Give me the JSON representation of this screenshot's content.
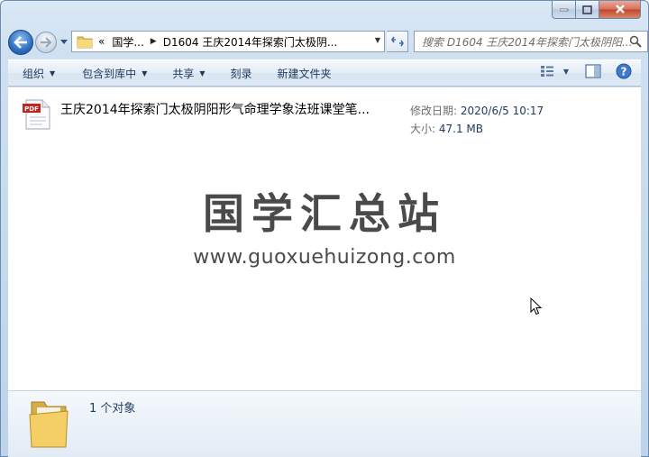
{
  "window": {
    "caption_buttons": [
      "minimize",
      "maximize",
      "close"
    ]
  },
  "nav": {
    "breadcrumb": {
      "overflow": "«",
      "items": [
        "国学...",
        "D1604 王庆2014年探索门太极阴..."
      ]
    },
    "search_placeholder": "搜索 D1604 王庆2014年探索门太极阴阳..."
  },
  "toolbar": {
    "items": [
      {
        "label": "组织",
        "dropdown": true
      },
      {
        "label": "包含到库中",
        "dropdown": true
      },
      {
        "label": "共享",
        "dropdown": true
      },
      {
        "label": "刻录",
        "dropdown": false
      },
      {
        "label": "新建文件夹",
        "dropdown": false
      }
    ]
  },
  "file": {
    "icon": "pdf-file-icon",
    "icon_text": "PDF",
    "name": "王庆2014年探索门太极阴阳形气命理学象法班课堂笔...",
    "modified_label": "修改日期:",
    "modified_value": "2020/6/5 10:17",
    "size_label": "大小:",
    "size_value": "47.1 MB"
  },
  "watermark": {
    "title": "国学汇总站",
    "url": "www.guoxuehuizong.com"
  },
  "details": {
    "count_text": "1 个对象"
  },
  "colors": {
    "chrome": "#cfe0f1",
    "toolbar_text": "#1e395b",
    "close_button": "#c2442a"
  }
}
